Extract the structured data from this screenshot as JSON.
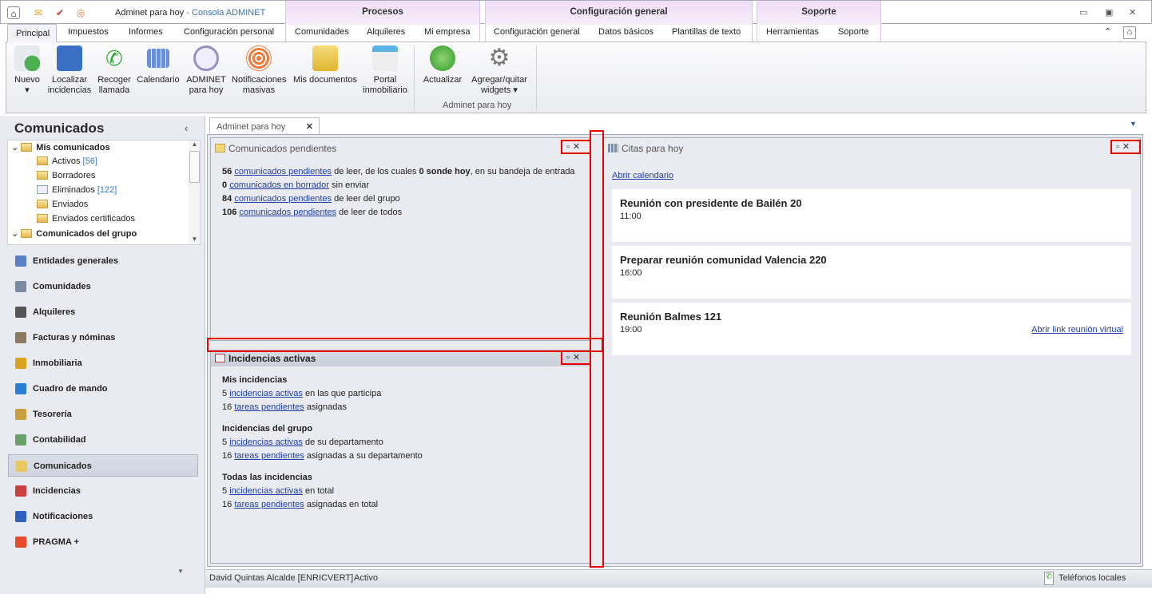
{
  "window": {
    "title": "Adminet para hoy",
    "title_suffix": " - Consola ADMINET"
  },
  "context_groups": [
    "Procesos",
    "Configuración general",
    "Soporte"
  ],
  "ribbon_tabs": [
    "Principal",
    "Impuestos",
    "Informes",
    "Configuración personal",
    "Comunidades",
    "Alquileres",
    "Mi empresa",
    "Configuración general",
    "Datos básicos",
    "Plantillas de texto",
    "Herramientas",
    "Soporte"
  ],
  "ribbon_buttons": [
    {
      "label": "Nuevo",
      "icon": "new-document-icon",
      "color": "#4caf50"
    },
    {
      "label": "Localizar incidencias",
      "icon": "file-cabinet-icon",
      "color": "#3b6fc4"
    },
    {
      "label": "Recoger llamada",
      "icon": "phone-icon",
      "color": "#2ea82e"
    },
    {
      "label": "Calendario",
      "icon": "calendar-icon",
      "color": "#6b8fd6"
    },
    {
      "label": "ADMINET para hoy",
      "icon": "clock-icon",
      "color": "#8fa3b8"
    },
    {
      "label": "Notificaciones masivas",
      "icon": "broadcast-icon",
      "color": "#f07a3a"
    },
    {
      "label": "Mis documentos",
      "icon": "folder-icon",
      "color": "#e8c23a"
    },
    {
      "label": "Portal inmobiliario",
      "icon": "portal-icon",
      "color": "#5ab4e6"
    },
    {
      "label": "Actualizar",
      "icon": "refresh-icon",
      "color": "#3fae3f"
    },
    {
      "label": "Agregar/quitar widgets",
      "icon": "gear-icon",
      "color": "#888888"
    }
  ],
  "ribbon_group": "Adminet para hoy",
  "sidebar": {
    "title": "Comunicados",
    "tree": [
      {
        "label": "Mis comunicados",
        "bold": true
      },
      {
        "label": "Activos",
        "count": "[56]"
      },
      {
        "label": "Borradores"
      },
      {
        "label": "Eliminados",
        "count": "[122]"
      },
      {
        "label": "Enviados"
      },
      {
        "label": "Enviados certificados"
      },
      {
        "label": "Comunicados del grupo",
        "bold": true
      }
    ],
    "nav": [
      {
        "label": "Entidades generales",
        "color": "#5b7fc4"
      },
      {
        "label": "Comunidades",
        "color": "#7a8aa0"
      },
      {
        "label": "Alquileres",
        "color": "#555555"
      },
      {
        "label": "Facturas y nóminas",
        "color": "#8a7a60"
      },
      {
        "label": "Inmobiliaria",
        "color": "#d9a520"
      },
      {
        "label": "Cuadro de mando",
        "color": "#2a7fd4"
      },
      {
        "label": "Tesorería",
        "color": "#c9a040"
      },
      {
        "label": "Contabilidad",
        "color": "#6aa06a"
      },
      {
        "label": "Comunicados",
        "color": "#e8c860",
        "selected": true
      },
      {
        "label": "Incidencias",
        "color": "#c84040"
      },
      {
        "label": "Notificaciones",
        "color": "#3060c0"
      },
      {
        "label": "PRAGMA +",
        "color": "#e84a2a"
      }
    ]
  },
  "doc_tab": {
    "label": "Adminet para hoy",
    "close": "✕"
  },
  "comunicados": {
    "title": "Comunicados pendientes",
    "lines": [
      {
        "n": "56",
        "link": "comunicados pendientes",
        "rest": " de leer, de los cuales ",
        "b2": "0 sonde hoy",
        "rest2": ", en su bandeja de entrada"
      },
      {
        "n": "0",
        "link": "comunicados en borrador",
        "rest": " sin enviar"
      },
      {
        "n": "84",
        "link": "comunicados pendientes",
        "rest": " de leer del grupo"
      },
      {
        "n": "106",
        "link": "comunicados pendientes",
        "rest": " de leer de todos"
      }
    ]
  },
  "incidencias": {
    "title": "Incidencias activas",
    "sections": [
      {
        "header": "Mis incidencias",
        "a_n": "5",
        "a_link": "incidencias activas",
        "a_rest": " en las que participa",
        "t_n": "16",
        "t_link": "tareas pendientes",
        "t_rest": " asignadas"
      },
      {
        "header": "Incidencias del grupo",
        "a_n": "5",
        "a_link": "incidencias activas",
        "a_rest": " de su departamento",
        "t_n": "16",
        "t_link": "tareas pendientes",
        "t_rest": " asignadas a su departamento"
      },
      {
        "header": "Todas las incidencias",
        "a_n": "5",
        "a_link": "incidencias activas",
        "a_rest": " en total",
        "t_n": "16",
        "t_link": "tareas pendientes",
        "t_rest": " asignadas en total"
      }
    ]
  },
  "citas": {
    "title": "Citas para hoy",
    "open_calendar": "Abrir calendario",
    "items": [
      {
        "title": "Reunión con presidente de Bailén 20",
        "time": "11:00"
      },
      {
        "title": "Preparar reunión comunidad Valencia 220",
        "time": "16:00"
      },
      {
        "title": "Reunión Balmes 121",
        "time": "19:00",
        "link": "Abrir link reunión virtual"
      }
    ]
  },
  "status": {
    "user": "David Quintas Alcalde [ENRICVERT]",
    "state": "Activo",
    "phones": "Teléfonos locales"
  }
}
